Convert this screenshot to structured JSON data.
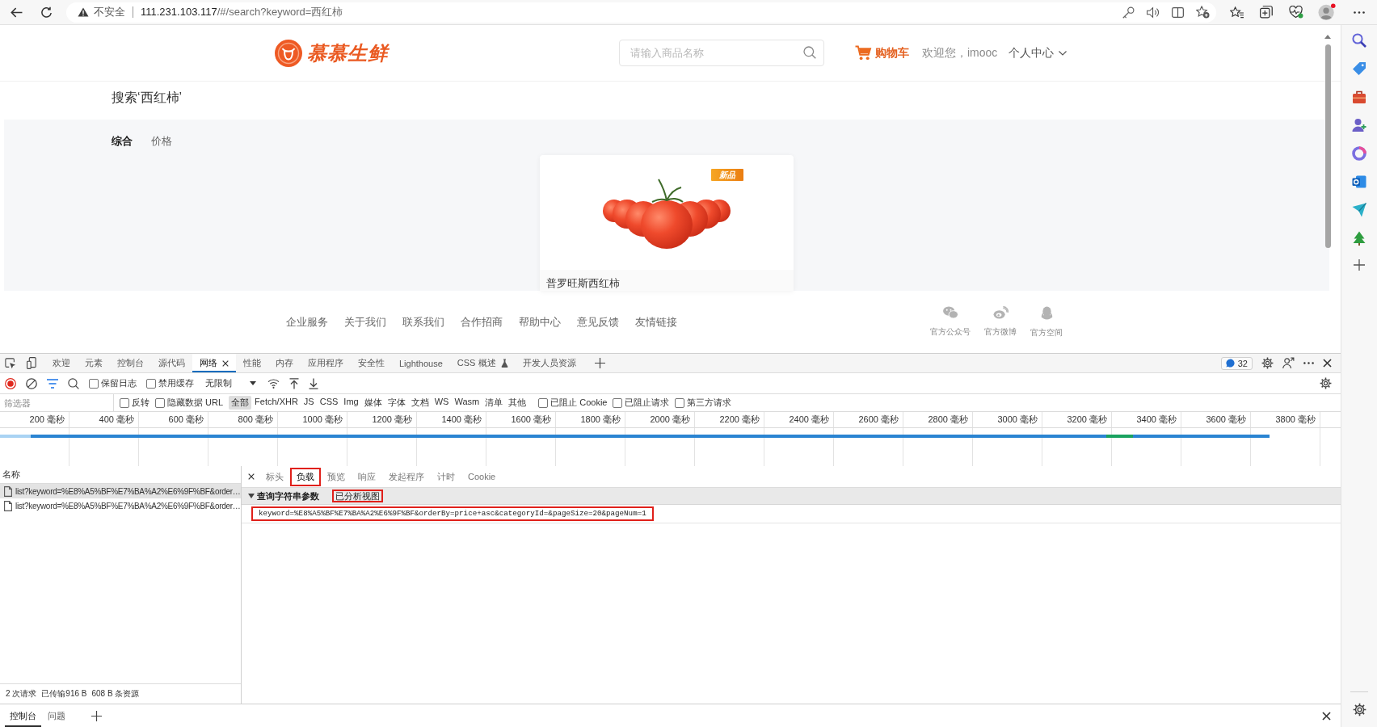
{
  "browser": {
    "security_label": "不安全",
    "url_host": "111.231.103.117",
    "url_path": "/#/search?keyword=西红柿"
  },
  "site": {
    "logo_text": "慕慕生鲜",
    "search_placeholder": "请输入商品名称",
    "cart_label": "购物车",
    "welcome": "欢迎您，imooc",
    "user_menu": "个人中心"
  },
  "search_title": "搜索‘西红柿’",
  "sort_tabs": [
    {
      "label": "综合",
      "selected": true
    },
    {
      "label": "价格",
      "selected": false
    }
  ],
  "products": [
    {
      "title": "普罗旺斯西红柿",
      "badge": "新品"
    }
  ],
  "footer_links": [
    "企业服务",
    "关于我们",
    "联系我们",
    "合作招商",
    "帮助中心",
    "意见反馈",
    "友情链接"
  ],
  "social_links": [
    {
      "kind": "wechat",
      "label": "官方公众号"
    },
    {
      "kind": "weibo",
      "label": "官方微博"
    },
    {
      "kind": "qq",
      "label": "官方空间"
    }
  ],
  "devtools": {
    "tabs": [
      {
        "label": "欢迎",
        "selected": false,
        "closable": false,
        "experimental": false
      },
      {
        "label": "元素",
        "selected": false,
        "closable": false,
        "experimental": false
      },
      {
        "label": "控制台",
        "selected": false,
        "closable": false,
        "experimental": false
      },
      {
        "label": "源代码",
        "selected": false,
        "closable": false,
        "experimental": false
      },
      {
        "label": "网络",
        "selected": true,
        "closable": true,
        "experimental": false
      },
      {
        "label": "性能",
        "selected": false,
        "closable": false,
        "experimental": false
      },
      {
        "label": "内存",
        "selected": false,
        "closable": false,
        "experimental": false
      },
      {
        "label": "应用程序",
        "selected": false,
        "closable": false,
        "experimental": false
      },
      {
        "label": "安全性",
        "selected": false,
        "closable": false,
        "experimental": false
      },
      {
        "label": "Lighthouse",
        "selected": false,
        "closable": false,
        "experimental": false
      },
      {
        "label": "CSS 概述",
        "selected": false,
        "closable": false,
        "experimental": true
      },
      {
        "label": "开发人员资源",
        "selected": false,
        "closable": false,
        "experimental": false
      }
    ],
    "issues_count": "32",
    "toolbar": {
      "recording": true,
      "options": [
        {
          "label": "保留日志",
          "checked": false
        },
        {
          "label": "禁用缓存",
          "checked": false
        }
      ],
      "throttling": "无限制"
    },
    "filter": {
      "placeholder": "筛选器",
      "options": [
        {
          "label": "反转",
          "checked": false
        },
        {
          "label": "隐藏数据 URL",
          "checked": false
        }
      ],
      "types": [
        {
          "label": "全部",
          "selected": true
        },
        {
          "label": "Fetch/XHR",
          "selected": false
        },
        {
          "label": "JS",
          "selected": false
        },
        {
          "label": "CSS",
          "selected": false
        },
        {
          "label": "Img",
          "selected": false
        },
        {
          "label": "媒体",
          "selected": false
        },
        {
          "label": "字体",
          "selected": false
        },
        {
          "label": "文档",
          "selected": false
        },
        {
          "label": "WS",
          "selected": false
        },
        {
          "label": "Wasm",
          "selected": false
        },
        {
          "label": "清单",
          "selected": false
        },
        {
          "label": "其他",
          "selected": false
        }
      ],
      "more_options": [
        {
          "label": "已阻止 Cookie",
          "checked": false
        },
        {
          "label": "已阻止请求",
          "checked": false
        },
        {
          "label": "第三方请求",
          "checked": false
        }
      ]
    },
    "timeline_ticks": [
      "200 毫秒",
      "400 毫秒",
      "600 毫秒",
      "800 毫秒",
      "1000 毫秒",
      "1200 毫秒",
      "1400 毫秒",
      "1600 毫秒",
      "1800 毫秒",
      "2000 毫秒",
      "2200 毫秒",
      "2400 毫秒",
      "2600 毫秒",
      "2800 毫秒",
      "3000 毫秒",
      "3200 毫秒",
      "3400 毫秒",
      "3600 毫秒",
      "3800 毫秒"
    ],
    "requests": {
      "column": "名称",
      "rows": [
        {
          "name": "list?keyword=%E8%A5%BF%E7%BA%A2%E6%9F%BF&order…",
          "selected": true
        },
        {
          "name": "list?keyword=%E8%A5%BF%E7%BA%A2%E6%9F%BF&order…",
          "selected": false
        }
      ]
    },
    "detail": {
      "tabs": [
        {
          "label": "标头",
          "selected": false,
          "highlighted": false
        },
        {
          "label": "负载",
          "selected": true,
          "highlighted": true
        },
        {
          "label": "预览",
          "selected": false,
          "highlighted": false
        },
        {
          "label": "响应",
          "selected": false,
          "highlighted": false
        },
        {
          "label": "发起程序",
          "selected": false,
          "highlighted": false
        },
        {
          "label": "计时",
          "selected": false,
          "highlighted": false
        },
        {
          "label": "Cookie",
          "selected": false,
          "highlighted": false
        }
      ],
      "section": {
        "title": "查询字符串参数",
        "expanded": true,
        "toggle": {
          "label": "已分析视图",
          "highlighted": true
        }
      },
      "query": {
        "text": "keyword=%E8%A5%BF%E7%BA%A2%E6%9F%BF&orderBy=price+asc&categoryId=&pageSize=20&pageNum=1",
        "highlighted": true
      }
    },
    "status": [
      "2 次请求",
      "已传输916 B",
      "608 B 条资源"
    ],
    "drawer_tabs": [
      {
        "label": "控制台",
        "selected": true
      },
      {
        "label": "问题",
        "selected": false
      }
    ]
  }
}
